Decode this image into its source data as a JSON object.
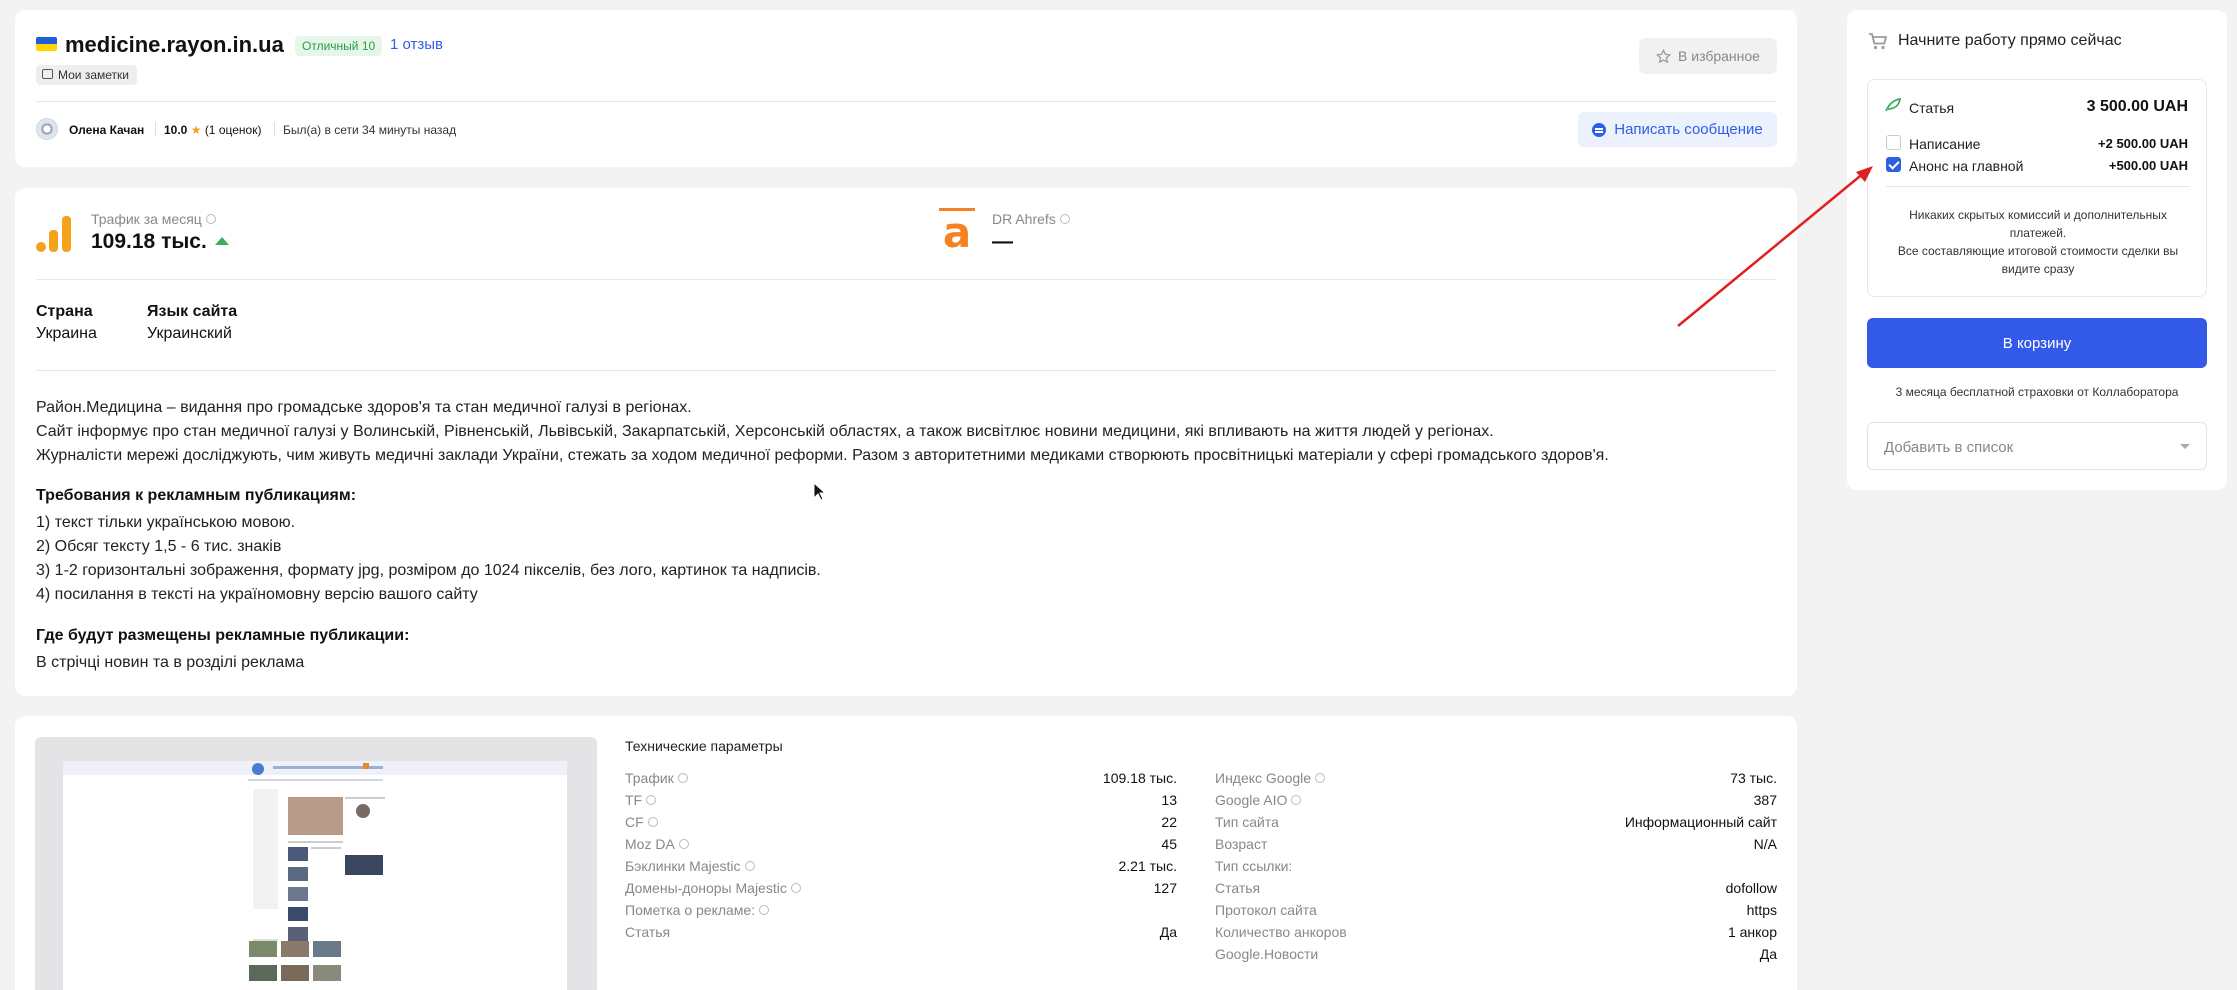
{
  "header": {
    "site": "medicine.rayon.in.ua",
    "rating_badge": "Отличный 10",
    "reviews": "1 отзыв",
    "notes": "Мои заметки",
    "favorite": "В избранное",
    "owner": {
      "name": "Олена Качан",
      "score": "10.0",
      "ratings": "(1 оценок)",
      "online": "Был(а) в сети 34 минуты назад"
    },
    "message_button": "Написать сообщение"
  },
  "stats": {
    "traffic_label": "Трафик за месяц",
    "traffic_value": "109.18 тыс.",
    "dr_label": "DR Ahrefs",
    "dr_value": "—",
    "country_label": "Страна",
    "country_value": "Украина",
    "lang_label": "Язык сайта",
    "lang_value": "Украинский"
  },
  "description": {
    "lines": [
      "Район.Медицина – видання про громадське здоров'я та стан медичної галузі в регіонах.",
      "Сайт інформує про стан медичної галузі у Волинській, Рівненській, Львівській, Закарпатській, Херсонській областях, а також висвітлює новини медицини, які впливають на життя людей у регіонах.",
      "Журналісти мережі досліджують, чим живуть медичні заклади України, стежать за ходом медичної реформи. Разом з авторитетними медиками створюють  просвітницькі матеріали у сфері громадського здоров'я."
    ],
    "req_title": "Требования к рекламным публикациям:",
    "requirements": [
      "1) текст тільки українською мовою.",
      "2) Обсяг тексту  1,5 - 6 тис. знаків",
      "3) 1-2 горизонтальні зображення, формату jpg,  розміром до 1024 пікселів, без лого, картинок та надписів.",
      "4) посилання в тексті на україномовну версію вашого сайту"
    ],
    "where_title": "Где будут размещены рекламные публикации:",
    "where_text": "В стрічці новин та в розділі реклама"
  },
  "tech": {
    "title": "Технические параметры",
    "left": [
      {
        "k": "Трафик",
        "v": "109.18 тыс.",
        "info": true
      },
      {
        "k": "TF",
        "v": "13",
        "info": true
      },
      {
        "k": "CF",
        "v": "22",
        "info": true
      },
      {
        "k": "Moz DA",
        "v": "45",
        "info": true
      },
      {
        "k": "Бэклинки Majestic",
        "v": "2.21 тыс.",
        "info": true
      },
      {
        "k": "Домены-доноры Majestic",
        "v": "127",
        "info": true
      },
      {
        "k": "Пометка о рекламе:",
        "v": "",
        "info": true
      },
      {
        "k": "Статья",
        "v": "Да",
        "info": false
      }
    ],
    "right": [
      {
        "k": "Индекс Google",
        "v": "73 тыс.",
        "info": true
      },
      {
        "k": "Google AIO",
        "v": "387",
        "info": true
      },
      {
        "k": "Тип сайта",
        "v": "Информационный сайт",
        "info": false
      },
      {
        "k": "Возраст",
        "v": "N/A",
        "info": false
      },
      {
        "k": "Тип ссылки:",
        "v": "",
        "info": false
      },
      {
        "k": "Статья",
        "v": "dofollow",
        "info": false
      },
      {
        "k": "Протокол сайта",
        "v": "https",
        "info": false
      },
      {
        "k": "Количество анкоров",
        "v": "1 анкор",
        "info": false
      },
      {
        "k": "Google.Новости",
        "v": "Да",
        "info": false
      }
    ]
  },
  "sidebar": {
    "heading": "Начните работу прямо сейчас",
    "article_label": "Статья",
    "article_price": "3 500.00 UAH",
    "opt1_label": "Написание",
    "opt1_price": "+2 500.00 UAH",
    "opt1_checked": false,
    "opt2_label": "Анонс на главной",
    "opt2_price": "+500.00 UAH",
    "opt2_checked": true,
    "note_line1": "Никаких скрытых комиссий и дополнительных платежей.",
    "note_line2": "Все составляющие итоговой стоимости сделки вы видите сразу",
    "cart_button": "В корзину",
    "insurance": "3 месяца бесплатной страховки от Коллаборатора",
    "list_placeholder": "Добавить в список"
  },
  "colors": {
    "accent": "#3259e8",
    "traffic_icon": "#f4a21c",
    "ahrefs": "#f58220",
    "arrow": "#e02020"
  }
}
